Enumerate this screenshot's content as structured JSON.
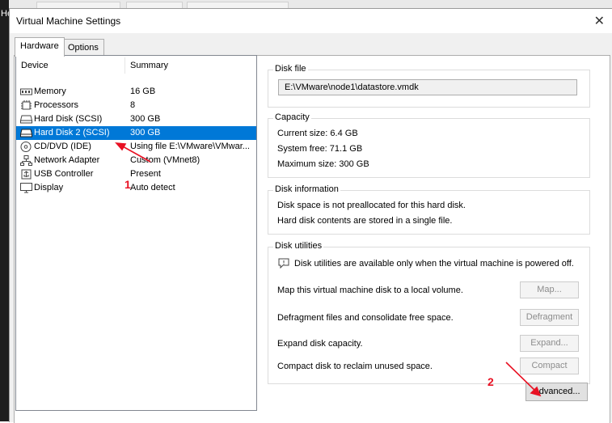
{
  "background": {
    "left_fragment": "He"
  },
  "dialog": {
    "title": "Virtual Machine Settings",
    "close_glyph": "✕"
  },
  "tabs": [
    {
      "label": "Hardware",
      "active": true
    },
    {
      "label": "Options",
      "active": false
    }
  ],
  "device_list": {
    "col_device": "Device",
    "col_summary": "Summary",
    "items": [
      {
        "name": "Memory",
        "summary": "16 GB",
        "icon": "memory-icon"
      },
      {
        "name": "Processors",
        "summary": "8",
        "icon": "processor-icon"
      },
      {
        "name": "Hard Disk (SCSI)",
        "summary": "300 GB",
        "icon": "hard-disk-icon"
      },
      {
        "name": "Hard Disk 2 (SCSI)",
        "summary": "300 GB",
        "icon": "hard-disk-icon",
        "selected": true
      },
      {
        "name": "CD/DVD (IDE)",
        "summary": "Using file E:\\VMware\\VMwar...",
        "icon": "cd-dvd-icon"
      },
      {
        "name": "Network Adapter",
        "summary": "Custom (VMnet8)",
        "icon": "network-adapter-icon"
      },
      {
        "name": "USB Controller",
        "summary": "Present",
        "icon": "usb-controller-icon"
      },
      {
        "name": "Display",
        "summary": "Auto detect",
        "icon": "display-icon"
      }
    ]
  },
  "disk_file": {
    "label": "Disk file",
    "value": "E:\\VMware\\node1\\datastore.vmdk"
  },
  "capacity": {
    "label": "Capacity",
    "current": "Current size: 6.4 GB",
    "free": "System free: 71.1 GB",
    "maximum": "Maximum size: 300 GB"
  },
  "disk_info": {
    "label": "Disk information",
    "line1": "Disk space is not preallocated for this hard disk.",
    "line2": "Hard disk contents are stored in a single file."
  },
  "disk_utilities": {
    "label": "Disk utilities",
    "notice": "Disk utilities are available only when the virtual machine is powered off.",
    "rows": [
      {
        "text": "Map this virtual machine disk to a local volume.",
        "button": "Map..."
      },
      {
        "text": "Defragment files and consolidate free space.",
        "button": "Defragment"
      },
      {
        "text": "Expand disk capacity.",
        "button": "Expand..."
      },
      {
        "text": "Compact disk to reclaim unused space.",
        "button": "Compact"
      }
    ]
  },
  "advanced_button": "Advanced...",
  "annotations": {
    "one": "1",
    "two": "2",
    "color": "#e81123"
  },
  "colors": {
    "selection": "#0078d7",
    "annotation": "#e81123"
  }
}
